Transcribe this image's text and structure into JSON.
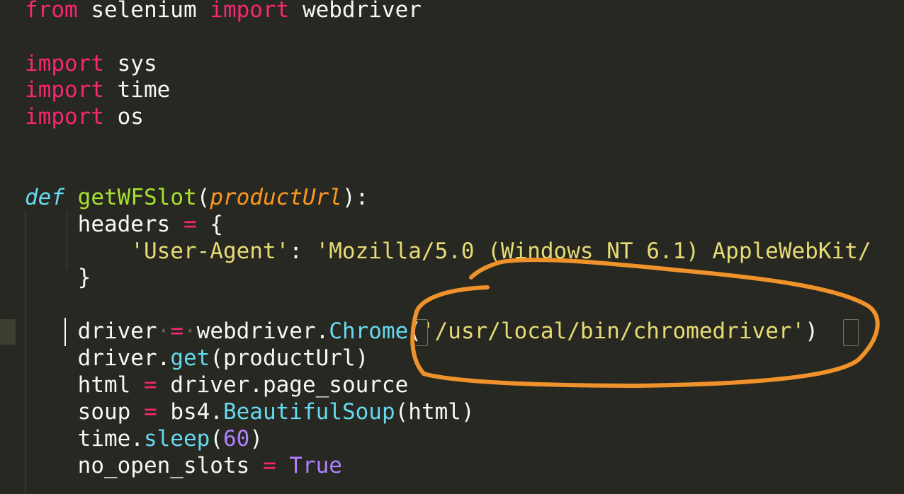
{
  "editor": {
    "lines": [
      {
        "tokens": [
          {
            "t": "from",
            "c": "kw"
          },
          {
            "t": " selenium ",
            "c": ""
          },
          {
            "t": "import",
            "c": "kw"
          },
          {
            "t": " webdriver",
            "c": ""
          }
        ]
      },
      {
        "tokens": []
      },
      {
        "tokens": [
          {
            "t": "import",
            "c": "kw"
          },
          {
            "t": " sys",
            "c": ""
          }
        ]
      },
      {
        "tokens": [
          {
            "t": "import",
            "c": "kw"
          },
          {
            "t": " time",
            "c": ""
          }
        ]
      },
      {
        "tokens": [
          {
            "t": "import",
            "c": "kw"
          },
          {
            "t": " os",
            "c": ""
          }
        ]
      },
      {
        "tokens": []
      },
      {
        "tokens": []
      },
      {
        "tokens": [
          {
            "t": "def",
            "c": "def"
          },
          {
            "t": " ",
            "c": ""
          },
          {
            "t": "getWFSlot",
            "c": "fn"
          },
          {
            "t": "(",
            "c": ""
          },
          {
            "t": "productUrl",
            "c": "param"
          },
          {
            "t": "):",
            "c": ""
          }
        ]
      },
      {
        "tokens": [
          {
            "t": "    headers ",
            "c": ""
          },
          {
            "t": "=",
            "c": "kw"
          },
          {
            "t": " {",
            "c": ""
          }
        ]
      },
      {
        "tokens": [
          {
            "t": "        ",
            "c": ""
          },
          {
            "t": "'User-Agent'",
            "c": "str"
          },
          {
            "t": ": ",
            "c": ""
          },
          {
            "t": "'Mozilla/5.0 (Windows NT 6.1) AppleWebKit/",
            "c": "str"
          }
        ]
      },
      {
        "tokens": [
          {
            "t": "    }",
            "c": ""
          }
        ]
      },
      {
        "tokens": []
      },
      {
        "tokens": [
          {
            "t": "    driver",
            "c": ""
          },
          {
            "t": "·",
            "c": "ws"
          },
          {
            "t": "=",
            "c": "kw"
          },
          {
            "t": "·",
            "c": "ws"
          },
          {
            "t": "webdriver.",
            "c": ""
          },
          {
            "t": "Chrome",
            "c": "cls"
          },
          {
            "t": "(",
            "c": ""
          },
          {
            "t": "'/usr/local/bin/chromedriver'",
            "c": "str"
          },
          {
            "t": ")",
            "c": ""
          }
        ]
      },
      {
        "tokens": [
          {
            "t": "    driver.",
            "c": ""
          },
          {
            "t": "get",
            "c": "cls"
          },
          {
            "t": "(productUrl)",
            "c": ""
          }
        ]
      },
      {
        "tokens": [
          {
            "t": "    html ",
            "c": ""
          },
          {
            "t": "=",
            "c": "kw"
          },
          {
            "t": " driver.page_source",
            "c": ""
          }
        ]
      },
      {
        "tokens": [
          {
            "t": "    soup ",
            "c": ""
          },
          {
            "t": "=",
            "c": "kw"
          },
          {
            "t": " bs4.",
            "c": ""
          },
          {
            "t": "BeautifulSoup",
            "c": "cls"
          },
          {
            "t": "(html)",
            "c": ""
          }
        ]
      },
      {
        "tokens": [
          {
            "t": "    time.",
            "c": ""
          },
          {
            "t": "sleep",
            "c": "cls"
          },
          {
            "t": "(",
            "c": ""
          },
          {
            "t": "60",
            "c": "num"
          },
          {
            "t": ")",
            "c": ""
          }
        ]
      },
      {
        "tokens": [
          {
            "t": "    no_open_slots ",
            "c": ""
          },
          {
            "t": "=",
            "c": "kw"
          },
          {
            "t": " ",
            "c": ""
          },
          {
            "t": "True",
            "c": "const"
          }
        ]
      }
    ],
    "current_line": 13
  },
  "colors": {
    "background": "#272822",
    "foreground": "#f8f8f2",
    "keyword": "#f92672",
    "string": "#e6db74",
    "function": "#a6e22e",
    "parameter": "#fd971f",
    "builtin": "#66d9ef",
    "number": "#ae81ff",
    "annotation": "#f0922b"
  }
}
